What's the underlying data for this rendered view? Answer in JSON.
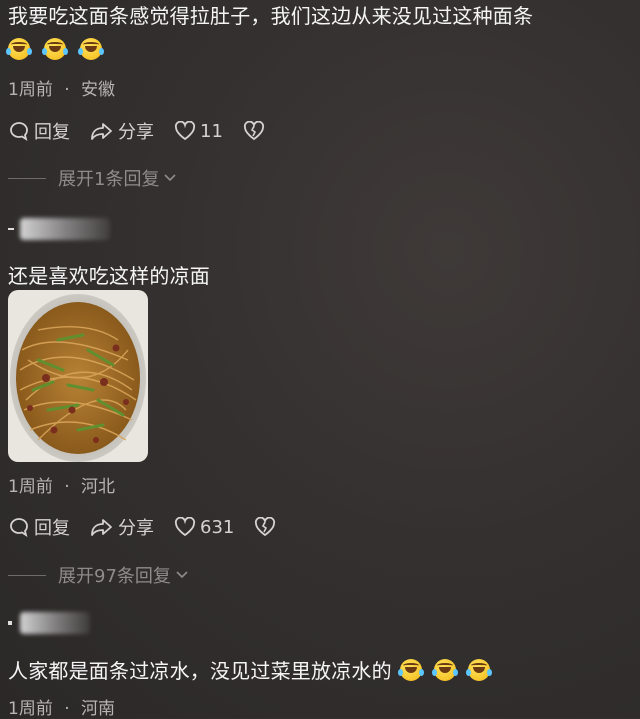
{
  "comments": [
    {
      "text": "我要吃这面条感觉得拉肚子，我们这边从来没见过这种面条",
      "emojis": [
        "laugh-cry-emoji",
        "laugh-cry-emoji",
        "laugh-cry-emoji"
      ],
      "time": "1周前",
      "location": "安徽",
      "reply_label": "回复",
      "share_label": "分享",
      "likes": "11",
      "expand_label": "展开1条回复"
    },
    {
      "text": "还是喜欢吃这样的凉面",
      "image_icon": "cold-noodles-photo",
      "time": "1周前",
      "location": "河北",
      "reply_label": "回复",
      "share_label": "分享",
      "likes": "631",
      "expand_label": "展开97条回复"
    },
    {
      "text": "人家都是面条过凉水，没见过菜里放凉水的",
      "emojis": [
        "laugh-cry-emoji",
        "laugh-cry-emoji",
        "laugh-cry-emoji"
      ],
      "time": "1周前",
      "location": "河南"
    }
  ],
  "separator": "·",
  "colors": {
    "background": "#343030",
    "meta": "#b8b4b2",
    "expand": "#8f8b89"
  }
}
